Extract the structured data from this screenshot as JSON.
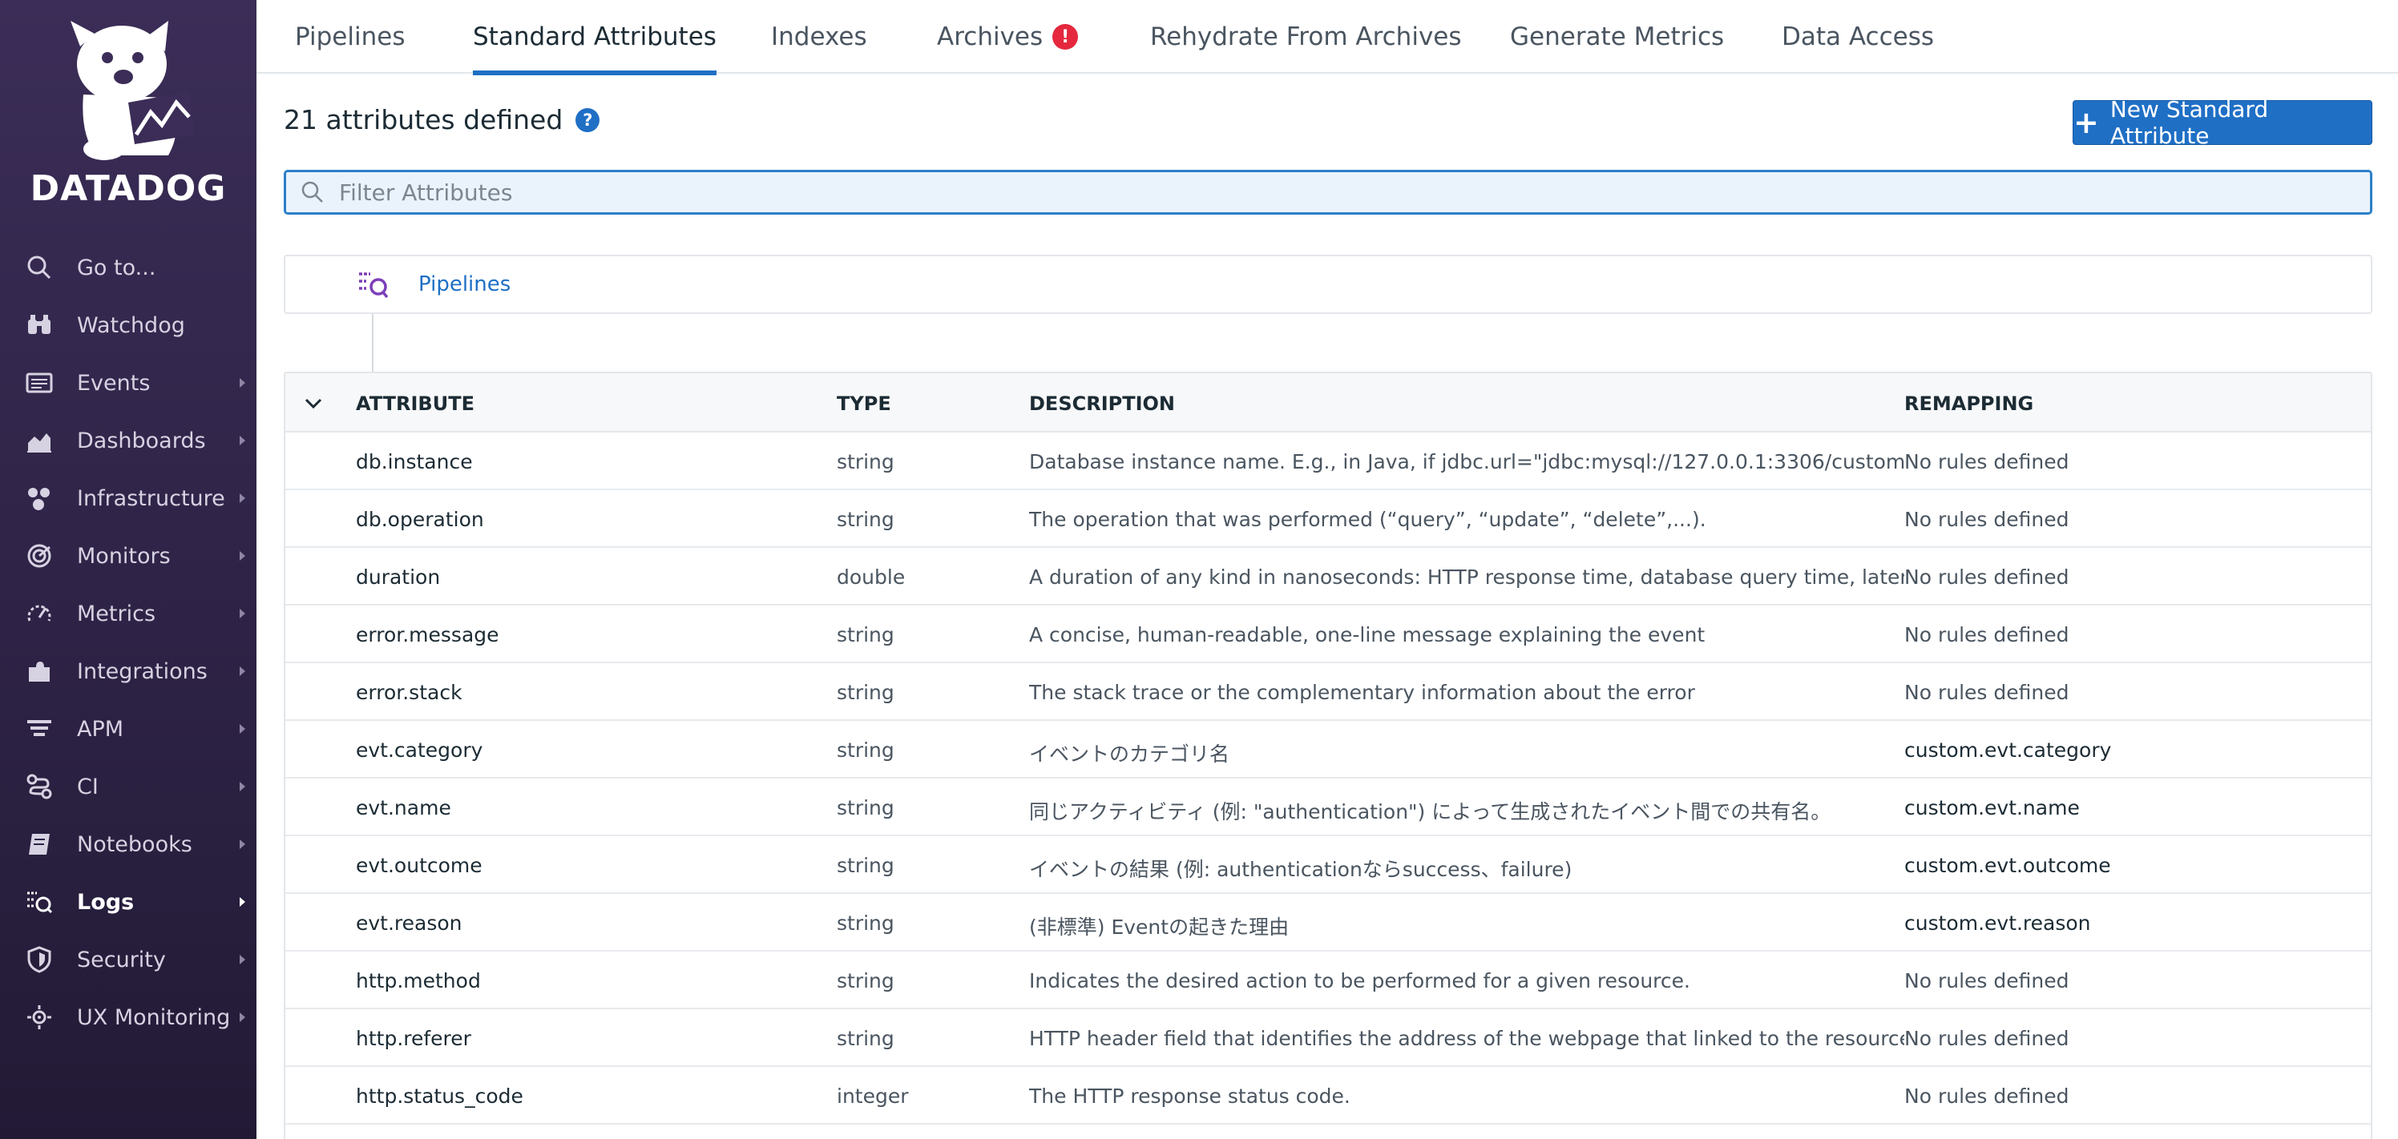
{
  "brand": {
    "name": "DATADOG"
  },
  "sidebar": {
    "items": [
      {
        "label": "Go to...",
        "icon": "search-icon",
        "has_chevron": false
      },
      {
        "label": "Watchdog",
        "icon": "binoculars-icon",
        "has_chevron": false
      },
      {
        "label": "Events",
        "icon": "events-icon",
        "has_chevron": true
      },
      {
        "label": "Dashboards",
        "icon": "dashboards-icon",
        "has_chevron": true
      },
      {
        "label": "Infrastructure",
        "icon": "infrastructure-icon",
        "has_chevron": true
      },
      {
        "label": "Monitors",
        "icon": "monitors-icon",
        "has_chevron": true
      },
      {
        "label": "Metrics",
        "icon": "metrics-icon",
        "has_chevron": true
      },
      {
        "label": "Integrations",
        "icon": "puzzle-icon",
        "has_chevron": true
      },
      {
        "label": "APM",
        "icon": "apm-icon",
        "has_chevron": true
      },
      {
        "label": "CI",
        "icon": "ci-icon",
        "has_chevron": true
      },
      {
        "label": "Notebooks",
        "icon": "notebook-icon",
        "has_chevron": true
      },
      {
        "label": "Logs",
        "icon": "logs-icon",
        "has_chevron": true,
        "active": true
      },
      {
        "label": "Security",
        "icon": "shield-icon",
        "has_chevron": true
      },
      {
        "label": "UX Monitoring",
        "icon": "ux-monitoring-icon",
        "has_chevron": true
      }
    ]
  },
  "tabs": [
    {
      "label": "Pipelines"
    },
    {
      "label": "Standard Attributes",
      "active": true
    },
    {
      "label": "Indexes"
    },
    {
      "label": "Archives",
      "alert": "!"
    },
    {
      "label": "Rehydrate From Archives"
    },
    {
      "label": "Generate Metrics"
    },
    {
      "label": "Data Access"
    }
  ],
  "header": {
    "count_title": "21 attributes defined",
    "help": "?",
    "new_button": {
      "plus": "+",
      "label": "New Standard Attribute"
    }
  },
  "filter": {
    "placeholder": "Filter Attributes",
    "value": ""
  },
  "pipelines_link": "Pipelines",
  "table": {
    "columns": [
      "ATTRIBUTE",
      "TYPE",
      "DESCRIPTION",
      "REMAPPING"
    ],
    "rows": [
      {
        "attribute": "db.instance",
        "type": "string",
        "description": "Database instance name. E.g., in Java, if jdbc.url=\"jdbc:mysql://127.0.0.1:3306/customers\", the instance name is customers.",
        "remapping": "No rules defined"
      },
      {
        "attribute": "db.operation",
        "type": "string",
        "description": "The operation that was performed (“query”, “update”, “delete”,...).",
        "remapping": "No rules defined"
      },
      {
        "attribute": "duration",
        "type": "double",
        "description": "A duration of any kind in nanoseconds: HTTP response time, database query time, latency, etc.",
        "remapping": "No rules defined"
      },
      {
        "attribute": "error.message",
        "type": "string",
        "description": "A concise, human-readable, one-line message explaining the event",
        "remapping": "No rules defined"
      },
      {
        "attribute": "error.stack",
        "type": "string",
        "description": "The stack trace or the complementary information about the error",
        "remapping": "No rules defined"
      },
      {
        "attribute": "evt.category",
        "type": "string",
        "description": "イベントのカテゴリ名",
        "remapping": "custom.evt.category"
      },
      {
        "attribute": "evt.name",
        "type": "string",
        "description": "同じアクティビティ (例: \"authentication\") によって生成されたイベント間での共有名。",
        "remapping": "custom.evt.name"
      },
      {
        "attribute": "evt.outcome",
        "type": "string",
        "description": "イベントの結果 (例: authenticationならsuccess、failure)",
        "remapping": "custom.evt.outcome"
      },
      {
        "attribute": "evt.reason",
        "type": "string",
        "description": "(非標準) Eventの起きた理由",
        "remapping": "custom.evt.reason"
      },
      {
        "attribute": "http.method",
        "type": "string",
        "description": "Indicates the desired action to be performed for a given resource.",
        "remapping": "No rules defined"
      },
      {
        "attribute": "http.referer",
        "type": "string",
        "description": "HTTP header field that identifies the address of the webpage that linked to the resource being requested.",
        "remapping": "No rules defined"
      },
      {
        "attribute": "http.status_code",
        "type": "integer",
        "description": "The HTTP response status code.",
        "remapping": "No rules defined"
      }
    ]
  },
  "colors": {
    "accent": "#1f6fc5",
    "sidebar_bg": "#2e2346",
    "alert": "#e5283d",
    "filter_bg": "#eaf3fb"
  }
}
